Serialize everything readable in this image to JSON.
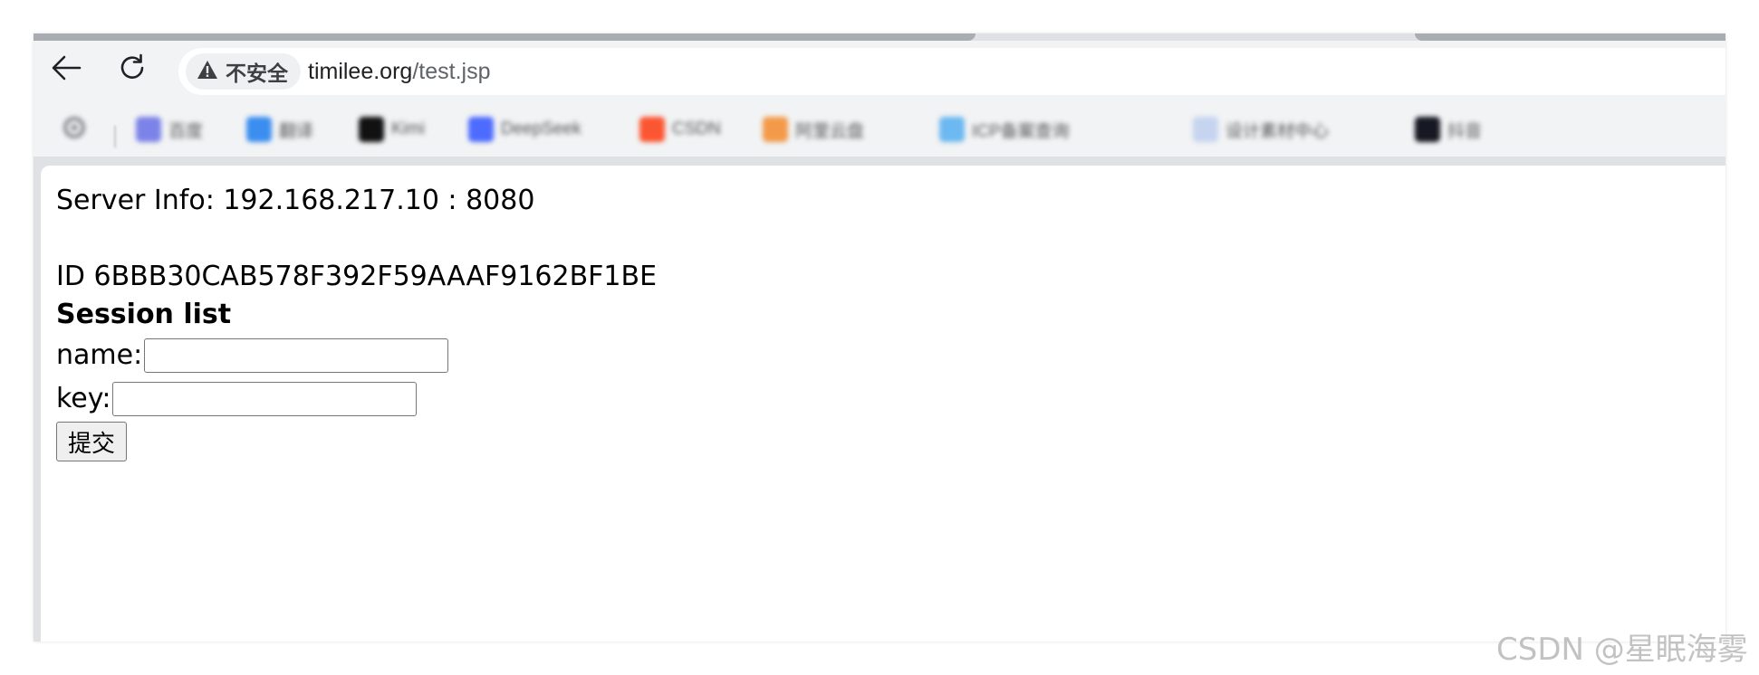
{
  "browser": {
    "security_label": "不安全",
    "url_host": "timilee.org",
    "url_path": "/test.jsp"
  },
  "bookmarks": [
    {
      "label": "百度",
      "color": "#7b83e8"
    },
    {
      "label": "翻译",
      "color": "#3b8ef0"
    },
    {
      "label": "Kimi",
      "color": "#111111"
    },
    {
      "label": "DeepSeek",
      "color": "#4d6bfe"
    },
    {
      "label": "CSDN",
      "color": "#fc5531"
    },
    {
      "label": "阿里云盘",
      "color": "#f39a4a"
    },
    {
      "label": "ICP备案查询",
      "color": "#6cb8f0"
    },
    {
      "label": "设计素材中心",
      "color": "#c6d4f0"
    },
    {
      "label": "抖音",
      "color": "#161823"
    }
  ],
  "page": {
    "server_info": "Server Info: 192.168.217.10 : 8080",
    "session_id": "ID 6BBB30CAB578F392F59AAAF9162BF1BE",
    "session_heading": "Session list",
    "name_label": "name:",
    "name_value": "",
    "key_label": "key:",
    "key_value": "",
    "submit_label": "提交"
  },
  "watermark": "CSDN @星眠海雾"
}
